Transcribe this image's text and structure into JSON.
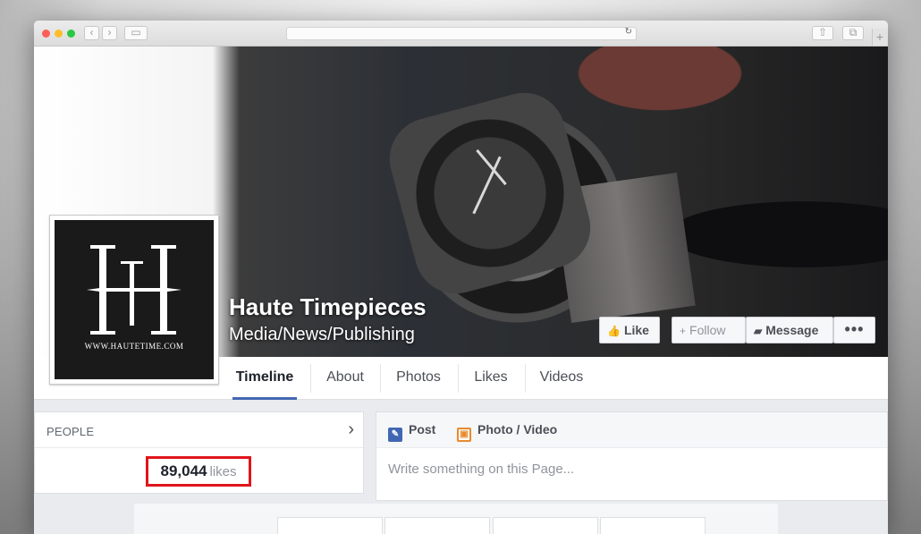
{
  "browser": {
    "back_icon": "chevron-left-icon",
    "forward_icon": "chevron-right-icon",
    "sidebar_icon": "sidebar-icon",
    "reload_icon": "reload-icon",
    "share_icon": "share-icon",
    "tabs_icon": "tabs-icon",
    "new_tab_label": "+"
  },
  "page": {
    "name": "Haute Timepieces",
    "category": "Media/News/Publishing",
    "logo_url_text": "WWW.HAUTETIME.COM"
  },
  "actions": {
    "like_label": "Like",
    "follow_label": "Follow",
    "message_label": "Message",
    "more_label": "•••"
  },
  "tabs": [
    {
      "label": "Timeline",
      "active": true
    },
    {
      "label": "About"
    },
    {
      "label": "Photos"
    },
    {
      "label": "Likes"
    },
    {
      "label": "Videos"
    }
  ],
  "people": {
    "title": "PEOPLE",
    "likes_count": "89,044",
    "likes_label": "likes",
    "highlight_color": "#e0151b"
  },
  "composer": {
    "post_label": "Post",
    "photo_label": "Photo / Video",
    "placeholder": "Write something on this Page..."
  },
  "colors": {
    "accent": "#4267b2"
  }
}
